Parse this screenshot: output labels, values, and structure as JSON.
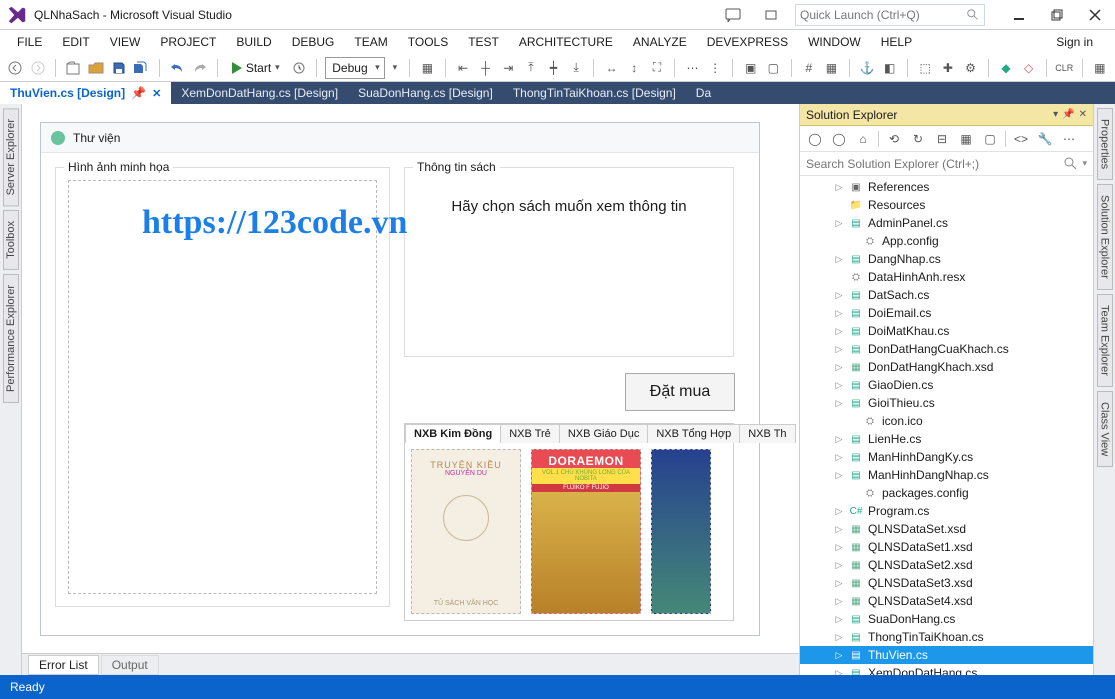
{
  "title": "QLNhaSach - Microsoft Visual Studio",
  "quick_launch_placeholder": "Quick Launch (Ctrl+Q)",
  "signin": "Sign in",
  "menu": [
    "FILE",
    "EDIT",
    "VIEW",
    "PROJECT",
    "BUILD",
    "DEBUG",
    "TEAM",
    "TOOLS",
    "TEST",
    "ARCHITECTURE",
    "ANALYZE",
    "DEVEXPRESS",
    "WINDOW",
    "HELP"
  ],
  "toolbar": {
    "start": "Start",
    "config": "Debug"
  },
  "doc_tabs": [
    {
      "label": "ThuVien.cs [Design]",
      "active": true,
      "closable": true,
      "preview": true
    },
    {
      "label": "XemDonDatHang.cs [Design]",
      "active": false,
      "closable": false
    },
    {
      "label": "SuaDonHang.cs [Design]",
      "active": false,
      "closable": false
    },
    {
      "label": "ThongTinTaiKhoan.cs [Design]",
      "active": false,
      "closable": false
    },
    {
      "label": "Da",
      "active": false,
      "closable": false
    }
  ],
  "left_wells": [
    "Server Explorer",
    "Toolbox",
    "Performance Explorer"
  ],
  "right_wells": [
    "Properties",
    "Solution Explorer",
    "Team Explorer",
    "Class View"
  ],
  "designer": {
    "window_title": "Thư viện",
    "group_image": "Hình ảnh minh họa",
    "group_info": "Thông tin sách",
    "info_prompt": "Hãy chọn sách muốn xem thông tin",
    "buy": "Đặt mua",
    "nxb_tabs": [
      "NXB Kim Đồng",
      "NXB Trẻ",
      "NXB Giáo Dục",
      "NXB Tổng Hợp",
      "NXB Th"
    ],
    "cover_a": {
      "title": "TRUYỆN KIỀU",
      "author": "NGUYỄN DU",
      "foot": "TỦ SÁCH VĂN HỌC"
    },
    "cover_b": {
      "logo": "DORAEMON",
      "bar": "VOL.1  CHÚ KHỦNG LONG CỦA NOBITA",
      "bar2": "FUJIKO F FUJIO"
    }
  },
  "watermark": "https://123code.vn",
  "bottom_tabs": [
    "Error List",
    "Output"
  ],
  "solution_explorer": {
    "title": "Solution Explorer",
    "search_placeholder": "Search Solution Explorer (Ctrl+;)",
    "nodes": [
      {
        "label": "References",
        "icon": "ref",
        "exp": true,
        "depth": 1
      },
      {
        "label": "Resources",
        "icon": "fold",
        "exp": false,
        "depth": 1
      },
      {
        "label": "AdminPanel.cs",
        "icon": "cs",
        "exp": true,
        "depth": 1
      },
      {
        "label": "App.config",
        "icon": "cfg",
        "exp": false,
        "depth": 2
      },
      {
        "label": "DangNhap.cs",
        "icon": "cs",
        "exp": true,
        "depth": 1
      },
      {
        "label": "DataHinhAnh.resx",
        "icon": "cfg",
        "exp": false,
        "depth": 1
      },
      {
        "label": "DatSach.cs",
        "icon": "cs",
        "exp": true,
        "depth": 1
      },
      {
        "label": "DoiEmail.cs",
        "icon": "cs",
        "exp": true,
        "depth": 1
      },
      {
        "label": "DoiMatKhau.cs",
        "icon": "cs",
        "exp": true,
        "depth": 1
      },
      {
        "label": "DonDatHangCuaKhach.cs",
        "icon": "cs",
        "exp": true,
        "depth": 1
      },
      {
        "label": "DonDatHangKhach.xsd",
        "icon": "xsd",
        "exp": true,
        "depth": 1
      },
      {
        "label": "GiaoDien.cs",
        "icon": "cs",
        "exp": true,
        "depth": 1
      },
      {
        "label": "GioiThieu.cs",
        "icon": "cs",
        "exp": true,
        "depth": 1
      },
      {
        "label": "icon.ico",
        "icon": "cfg",
        "exp": false,
        "depth": 2
      },
      {
        "label": "LienHe.cs",
        "icon": "cs",
        "exp": true,
        "depth": 1
      },
      {
        "label": "ManHinhDangKy.cs",
        "icon": "cs",
        "exp": true,
        "depth": 1
      },
      {
        "label": "ManHinhDangNhap.cs",
        "icon": "cs",
        "exp": true,
        "depth": 1
      },
      {
        "label": "packages.config",
        "icon": "cfg",
        "exp": false,
        "depth": 2
      },
      {
        "label": "Program.cs",
        "icon": "csmain",
        "exp": true,
        "depth": 1
      },
      {
        "label": "QLNSDataSet.xsd",
        "icon": "xsd",
        "exp": true,
        "depth": 1
      },
      {
        "label": "QLNSDataSet1.xsd",
        "icon": "xsd",
        "exp": true,
        "depth": 1
      },
      {
        "label": "QLNSDataSet2.xsd",
        "icon": "xsd",
        "exp": true,
        "depth": 1
      },
      {
        "label": "QLNSDataSet3.xsd",
        "icon": "xsd",
        "exp": true,
        "depth": 1
      },
      {
        "label": "QLNSDataSet4.xsd",
        "icon": "xsd",
        "exp": true,
        "depth": 1
      },
      {
        "label": "SuaDonHang.cs",
        "icon": "cs",
        "exp": true,
        "depth": 1
      },
      {
        "label": "ThongTinTaiKhoan.cs",
        "icon": "cs",
        "exp": true,
        "depth": 1
      },
      {
        "label": "ThuVien.cs",
        "icon": "cs",
        "exp": true,
        "depth": 1,
        "selected": true
      },
      {
        "label": "XemDonDatHang.cs",
        "icon": "cs",
        "exp": true,
        "depth": 1
      }
    ]
  },
  "status": "Ready"
}
